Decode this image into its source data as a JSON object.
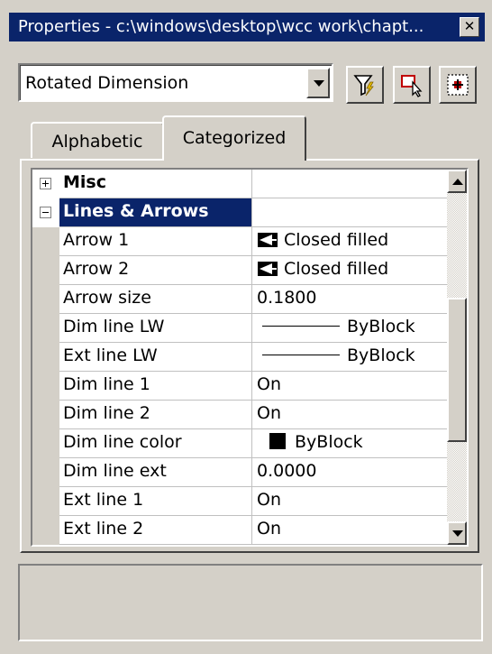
{
  "window": {
    "title": "Properties - c:\\windows\\desktop\\wcc work\\chapt...",
    "close_label": "✕"
  },
  "toolbar": {
    "object_type": "Rotated Dimension",
    "buttons": [
      {
        "icon": "quick-select-icon"
      },
      {
        "icon": "select-objects-icon"
      },
      {
        "icon": "toggle-pickadd-icon"
      }
    ]
  },
  "tabs": [
    {
      "label": "Alphabetic",
      "active": false
    },
    {
      "label": "Categorized",
      "active": true
    }
  ],
  "grid": {
    "categories": [
      {
        "label": "Misc",
        "expanded": false
      },
      {
        "label": "Lines & Arrows",
        "expanded": true,
        "selected": true
      }
    ],
    "rows": [
      {
        "name": "Arrow 1",
        "value": "Closed filled",
        "kind": "arrow"
      },
      {
        "name": "Arrow 2",
        "value": "Closed filled",
        "kind": "arrow"
      },
      {
        "name": "Arrow size",
        "value": "0.1800",
        "kind": "text"
      },
      {
        "name": "Dim line LW",
        "value": "ByBlock",
        "kind": "lineweight"
      },
      {
        "name": "Ext line LW",
        "value": "ByBlock",
        "kind": "lineweight"
      },
      {
        "name": "Dim line 1",
        "value": "On",
        "kind": "text"
      },
      {
        "name": "Dim line 2",
        "value": "On",
        "kind": "text"
      },
      {
        "name": "Dim line color",
        "value": "ByBlock",
        "kind": "color",
        "color": "#000000"
      },
      {
        "name": "Dim line ext",
        "value": "0.0000",
        "kind": "text"
      },
      {
        "name": "Ext line 1",
        "value": "On",
        "kind": "text"
      },
      {
        "name": "Ext line 2",
        "value": "On",
        "kind": "text"
      }
    ]
  },
  "colors": {
    "titlebar": "#0a246a",
    "selection": "#0a246a",
    "face": "#d4d0c8"
  }
}
